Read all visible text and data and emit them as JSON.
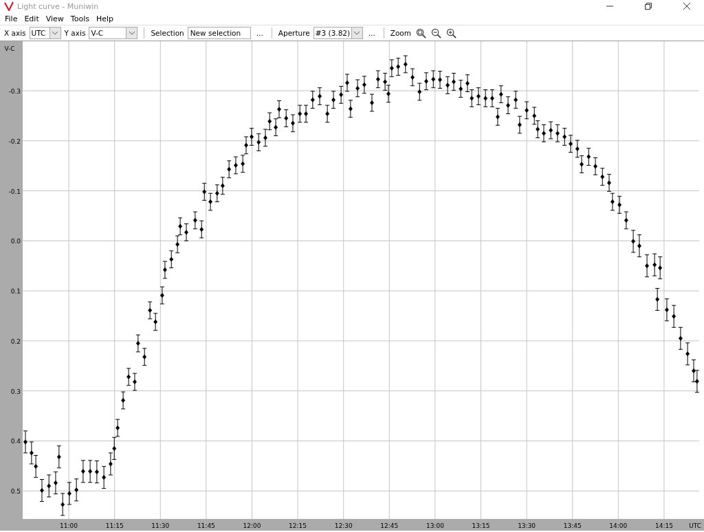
{
  "window": {
    "title": "Light curve - Muniwin"
  },
  "menu": [
    {
      "label": "File"
    },
    {
      "label": "Edit"
    },
    {
      "label": "View"
    },
    {
      "label": "Tools"
    },
    {
      "label": "Help"
    }
  ],
  "toolbar": {
    "x_axis": {
      "label": "X axis",
      "value": "UTC"
    },
    "y_axis": {
      "label": "Y axis",
      "value": "V-C"
    },
    "selection": {
      "label": "Selection",
      "value": "New selection",
      "more": "..."
    },
    "aperture": {
      "label": "Aperture",
      "value": "#3 (3.82)",
      "more": "..."
    },
    "zoom_label": "Zoom"
  },
  "chart": {
    "chart_data": {
      "type": "scatter",
      "xlabel": "UTC",
      "ylabel": "V-C",
      "x": [
        645.8,
        647.8,
        649.2,
        651.2,
        653.5,
        655.7,
        656.8,
        658.0,
        660.2,
        662.5,
        664.7,
        667.0,
        669.2,
        671.5,
        673.7,
        674.9,
        676.0,
        677.8,
        679.6,
        681.6,
        682.7,
        684.8,
        686.6,
        688.4,
        690.6,
        691.5,
        693.6,
        695.6,
        696.5,
        698.5,
        701.4,
        703.5,
        704.4,
        706.4,
        708.6,
        710.4,
        712.5,
        714.7,
        717.0,
        718.1,
        719.9,
        722.2,
        724.4,
        725.8,
        727.8,
        728.9,
        731.2,
        733.4,
        735.7,
        737.7,
        739.9,
        742.2,
        744.7,
        746.7,
        749.2,
        751.2,
        752.3,
        754.6,
        756.8,
        759.3,
        761.3,
        763.6,
        764.7,
        765.8,
        767.9,
        770.3,
        772.6,
        774.9,
        777.1,
        779.4,
        781.6,
        784.1,
        786.1,
        788.4,
        790.6,
        792.0,
        794.2,
        796.5,
        798.7,
        800.5,
        801.6,
        803.9,
        806.4,
        807.7,
        810.0,
        812.5,
        813.6,
        815.6,
        817.9,
        820.1,
        822.4,
        824.4,
        826.6,
        828.0,
        830.3,
        832.5,
        834.8,
        837.0,
        838.1,
        840.4,
        842.6,
        844.9,
        846.9,
        849.4,
        851.9,
        853.7,
        852.8,
        855.9,
        858.2,
        860.4,
        862.7,
        864.7,
        865.8
      ],
      "series": [
        {
          "color": "#000000",
          "values": [
            0.402,
            0.424,
            0.451,
            0.499,
            0.49,
            0.484,
            0.432,
            0.527,
            0.505,
            0.498,
            0.461,
            0.461,
            0.462,
            0.473,
            0.446,
            0.415,
            0.374,
            0.319,
            0.272,
            0.282,
            0.205,
            0.232,
            0.139,
            0.162,
            0.109,
            0.058,
            0.037,
            0.007,
            -0.029,
            -0.017,
            -0.041,
            -0.023,
            -0.098,
            -0.078,
            -0.095,
            -0.11,
            -0.143,
            -0.151,
            -0.154,
            -0.191,
            -0.208,
            -0.197,
            -0.206,
            -0.239,
            -0.227,
            -0.263,
            -0.245,
            -0.235,
            -0.254,
            -0.254,
            -0.282,
            -0.289,
            -0.254,
            -0.282,
            -0.292,
            -0.316,
            -0.264,
            -0.305,
            -0.312,
            -0.276,
            -0.323,
            -0.318,
            -0.294,
            -0.345,
            -0.348,
            -0.353,
            -0.327,
            -0.298,
            -0.319,
            -0.323,
            -0.322,
            -0.311,
            -0.318,
            -0.304,
            -0.315,
            -0.285,
            -0.289,
            -0.285,
            -0.285,
            -0.248,
            -0.293,
            -0.271,
            -0.282,
            -0.232,
            -0.261,
            -0.25,
            -0.223,
            -0.215,
            -0.221,
            -0.215,
            -0.208,
            -0.194,
            -0.184,
            -0.153,
            -0.168,
            -0.149,
            -0.128,
            -0.116,
            -0.078,
            -0.072,
            -0.041,
            0.001,
            0.01,
            0.05,
            0.048,
            0.054,
            0.117,
            0.138,
            0.151,
            0.195,
            0.226,
            0.26,
            0.281
          ],
          "errors": [
            0.022,
            0.022,
            0.022,
            0.022,
            0.022,
            0.022,
            0.022,
            0.022,
            0.022,
            0.022,
            0.022,
            0.022,
            0.022,
            0.022,
            0.022,
            0.022,
            0.017,
            0.017,
            0.017,
            0.017,
            0.017,
            0.017,
            0.017,
            0.017,
            0.017,
            0.017,
            0.017,
            0.017,
            0.017,
            0.017,
            0.017,
            0.017,
            0.017,
            0.017,
            0.017,
            0.017,
            0.017,
            0.017,
            0.017,
            0.017,
            0.017,
            0.017,
            0.017,
            0.017,
            0.017,
            0.017,
            0.017,
            0.017,
            0.017,
            0.017,
            0.017,
            0.017,
            0.017,
            0.017,
            0.017,
            0.017,
            0.017,
            0.017,
            0.017,
            0.017,
            0.017,
            0.017,
            0.017,
            0.017,
            0.017,
            0.017,
            0.017,
            0.017,
            0.017,
            0.017,
            0.017,
            0.017,
            0.017,
            0.017,
            0.017,
            0.017,
            0.017,
            0.017,
            0.017,
            0.017,
            0.017,
            0.017,
            0.017,
            0.017,
            0.017,
            0.017,
            0.017,
            0.017,
            0.017,
            0.017,
            0.017,
            0.017,
            0.017,
            0.017,
            0.017,
            0.017,
            0.017,
            0.017,
            0.017,
            0.017,
            0.017,
            0.022,
            0.022,
            0.022,
            0.022,
            0.022,
            0.022,
            0.022,
            0.022,
            0.022,
            0.022,
            0.022,
            0.022
          ]
        }
      ],
      "grid": true,
      "xlim": [
        644.9,
        866.5
      ],
      "ylim": [
        0.556,
        -0.399
      ],
      "xticks": [
        {
          "value": 660,
          "label": "11:00"
        },
        {
          "value": 675,
          "label": "11:15"
        },
        {
          "value": 690,
          "label": "11:30"
        },
        {
          "value": 705,
          "label": "11:45"
        },
        {
          "value": 720,
          "label": "12:00"
        },
        {
          "value": 735,
          "label": "12:15"
        },
        {
          "value": 750,
          "label": "12:30"
        },
        {
          "value": 765,
          "label": "12:45"
        },
        {
          "value": 780,
          "label": "13:00"
        },
        {
          "value": 795,
          "label": "13:15"
        },
        {
          "value": 810,
          "label": "13:30"
        },
        {
          "value": 825,
          "label": "13:45"
        },
        {
          "value": 840,
          "label": "14:00"
        },
        {
          "value": 855,
          "label": "14:15"
        }
      ],
      "yticks": [
        {
          "value": -0.3,
          "label": "-0.3"
        },
        {
          "value": -0.2,
          "label": "-0.2"
        },
        {
          "value": -0.1,
          "label": "-0.1"
        },
        {
          "value": 0,
          "label": "0.0"
        },
        {
          "value": 0.1,
          "label": "0.1"
        },
        {
          "value": 0.2,
          "label": "0.2"
        },
        {
          "value": 0.3,
          "label": "0.3"
        },
        {
          "value": 0.4,
          "label": "0.4"
        },
        {
          "value": 0.5,
          "label": "0.5"
        }
      ]
    }
  }
}
